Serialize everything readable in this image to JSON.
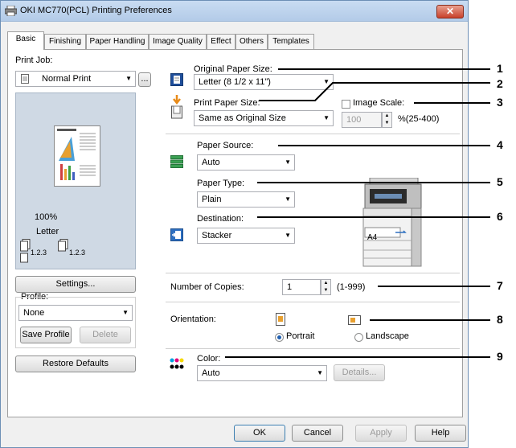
{
  "window": {
    "title": "OKI MC770(PCL) Printing Preferences",
    "close_label": "✕"
  },
  "tabs": [
    "Basic",
    "Finishing",
    "Paper Handling",
    "Image Quality",
    "Effect",
    "Others",
    "Templates"
  ],
  "left": {
    "print_job_label": "Print Job:",
    "print_job_value": "Normal Print",
    "more_button": "...",
    "preview": {
      "zoom": "100%",
      "paper": "Letter",
      "collate_a": "1.2.3",
      "collate_b": "1.2.3"
    },
    "settings_button": "Settings...",
    "profile_label": "Profile:",
    "profile_value": "None",
    "save_profile_button": "Save Profile",
    "delete_button": "Delete",
    "restore_defaults_button": "Restore Defaults"
  },
  "right": {
    "original_paper_size_label": "Original Paper Size:",
    "original_paper_size_value": "Letter (8 1/2 x 11\")",
    "print_paper_size_label": "Print Paper Size:",
    "print_paper_size_value": "Same as Original Size",
    "image_scale_label": "Image Scale:",
    "image_scale_value": "100",
    "image_scale_range": "%(25-400)",
    "paper_source_label": "Paper Source:",
    "paper_source_value": "Auto",
    "paper_type_label": "Paper Type:",
    "paper_type_value": "Plain",
    "destination_label": "Destination:",
    "destination_value": "Stacker",
    "printer_tray_label": "A4",
    "copies_label": "Number of Copies:",
    "copies_value": "1",
    "copies_range": "(1-999)",
    "orientation_label": "Orientation:",
    "portrait_label": "Portrait",
    "landscape_label": "Landscape",
    "color_label": "Color:",
    "color_value": "Auto",
    "details_button": "Details..."
  },
  "footer": {
    "ok": "OK",
    "cancel": "Cancel",
    "apply": "Apply",
    "help": "Help"
  },
  "callouts": [
    "1",
    "2",
    "3",
    "4",
    "5",
    "6",
    "7",
    "8",
    "9"
  ]
}
